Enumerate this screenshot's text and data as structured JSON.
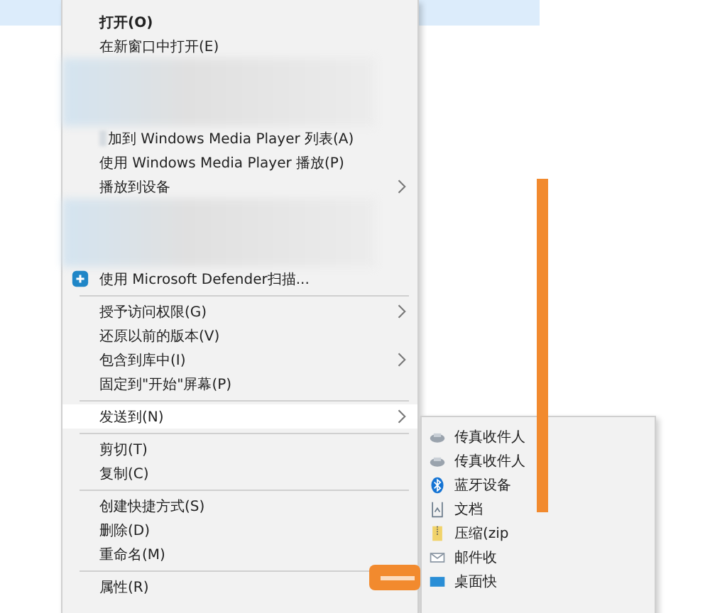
{
  "menu": {
    "items": [
      {
        "kind": "item",
        "label": "打开(O)",
        "bold": true,
        "submenu": false,
        "selected": false
      },
      {
        "kind": "item",
        "label": "在新窗口中打开(E)",
        "bold": false,
        "submenu": false,
        "selected": false
      },
      {
        "kind": "blurred"
      },
      {
        "kind": "partly-blurred",
        "label": "加到 Windows Media Player 列表(A)",
        "bold": false,
        "submenu": false,
        "selected": false
      },
      {
        "kind": "item",
        "label": "使用 Windows Media Player 播放(P)",
        "bold": false,
        "submenu": false,
        "selected": false
      },
      {
        "kind": "item",
        "label": "播放到设备",
        "bold": false,
        "submenu": true,
        "selected": false
      },
      {
        "kind": "blurred"
      },
      {
        "kind": "scan",
        "label": "使用 Microsoft Defender扫描...",
        "bold": false,
        "submenu": false,
        "selected": false
      },
      {
        "kind": "separator"
      },
      {
        "kind": "item",
        "label": "授予访问权限(G)",
        "bold": false,
        "submenu": true,
        "selected": false
      },
      {
        "kind": "item",
        "label": "还原以前的版本(V)",
        "bold": false,
        "submenu": false,
        "selected": false
      },
      {
        "kind": "item",
        "label": "包含到库中(I)",
        "bold": false,
        "submenu": true,
        "selected": false
      },
      {
        "kind": "item",
        "label": "固定到\"开始\"屏幕(P)",
        "bold": false,
        "submenu": false,
        "selected": false
      },
      {
        "kind": "separator"
      },
      {
        "kind": "item",
        "label": "发送到(N)",
        "bold": false,
        "submenu": true,
        "selected": true
      },
      {
        "kind": "separator"
      },
      {
        "kind": "item",
        "label": "剪切(T)",
        "bold": false,
        "submenu": false,
        "selected": false
      },
      {
        "kind": "item",
        "label": "复制(C)",
        "bold": false,
        "submenu": false,
        "selected": false
      },
      {
        "kind": "separator"
      },
      {
        "kind": "item",
        "label": "创建快捷方式(S)",
        "bold": false,
        "submenu": false,
        "selected": false
      },
      {
        "kind": "item",
        "label": "删除(D)",
        "bold": false,
        "submenu": false,
        "selected": false
      },
      {
        "kind": "item",
        "label": "重命名(M)",
        "bold": false,
        "submenu": false,
        "selected": false
      },
      {
        "kind": "separator"
      },
      {
        "kind": "item",
        "label": "属性(R)",
        "bold": false,
        "submenu": false,
        "selected": false
      }
    ]
  },
  "send_to_submenu": {
    "items": [
      {
        "kind": "fax",
        "label": "传真收件人"
      },
      {
        "kind": "fax",
        "label": "传真收件人"
      },
      {
        "kind": "bluetooth",
        "label": "蓝牙设备"
      },
      {
        "kind": "document",
        "label": "文档"
      },
      {
        "kind": "zip",
        "label": "压缩(zip"
      },
      {
        "kind": "mail",
        "label": "邮件收"
      },
      {
        "kind": "desktop",
        "label": "桌面快"
      }
    ]
  }
}
